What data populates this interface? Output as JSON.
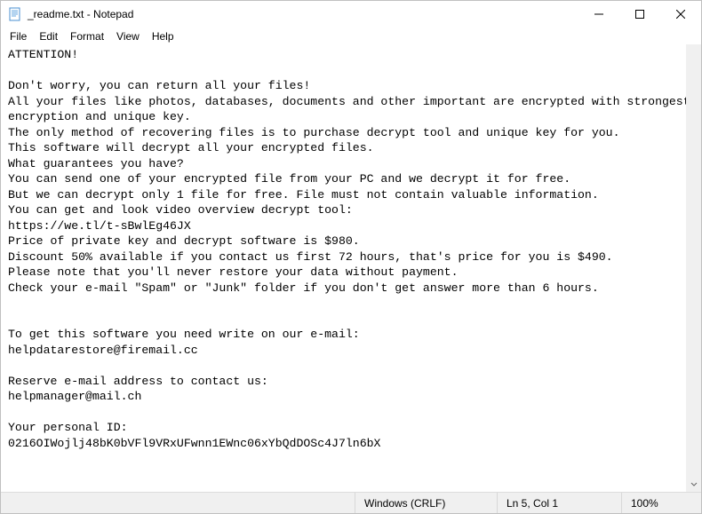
{
  "titlebar": {
    "title": "_readme.txt - Notepad"
  },
  "menu": {
    "file": "File",
    "edit": "Edit",
    "format": "Format",
    "view": "View",
    "help": "Help"
  },
  "document": {
    "text": "ATTENTION!\n\nDon't worry, you can return all your files!\nAll your files like photos, databases, documents and other important are encrypted with strongest encryption and unique key.\nThe only method of recovering files is to purchase decrypt tool and unique key for you.\nThis software will decrypt all your encrypted files.\nWhat guarantees you have?\nYou can send one of your encrypted file from your PC and we decrypt it for free.\nBut we can decrypt only 1 file for free. File must not contain valuable information.\nYou can get and look video overview decrypt tool:\nhttps://we.tl/t-sBwlEg46JX\nPrice of private key and decrypt software is $980.\nDiscount 50% available if you contact us first 72 hours, that's price for you is $490.\nPlease note that you'll never restore your data without payment.\nCheck your e-mail \"Spam\" or \"Junk\" folder if you don't get answer more than 6 hours.\n\n\nTo get this software you need write on our e-mail:\nhelpdatarestore@firemail.cc\n\nReserve e-mail address to contact us:\nhelpmanager@mail.ch\n\nYour personal ID:\n0216OIWojlj48bK0bVFl9VRxUFwnn1EWnc06xYbQdDOSc4J7ln6bX"
  },
  "status": {
    "encoding": "Windows (CRLF)",
    "position": "Ln 5, Col 1",
    "zoom": "100%"
  }
}
